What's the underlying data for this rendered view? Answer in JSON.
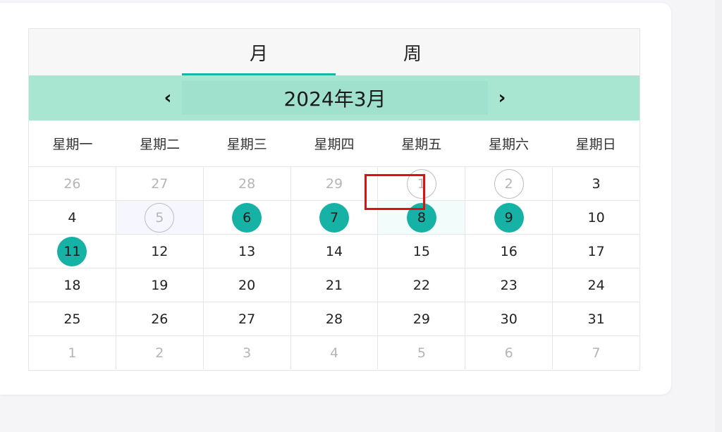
{
  "tabs": [
    {
      "label": "月",
      "active": true
    },
    {
      "label": "周",
      "active": false
    }
  ],
  "header": {
    "month_label": "2024年3月",
    "prev_icon": "‹",
    "next_icon": "›"
  },
  "weekdays": [
    "星期一",
    "星期二",
    "星期三",
    "星期四",
    "星期五",
    "星期六",
    "星期日"
  ],
  "weeks": [
    [
      {
        "day": "26",
        "state": "muted"
      },
      {
        "day": "27",
        "state": "muted"
      },
      {
        "day": "28",
        "state": "muted"
      },
      {
        "day": "29",
        "state": "muted"
      },
      {
        "day": "1",
        "state": "outlined"
      },
      {
        "day": "2",
        "state": "outlined"
      },
      {
        "day": "3",
        "state": "normal"
      }
    ],
    [
      {
        "day": "4",
        "state": "normal"
      },
      {
        "day": "5",
        "state": "outlined"
      },
      {
        "day": "6",
        "state": "filled"
      },
      {
        "day": "7",
        "state": "filled"
      },
      {
        "day": "8",
        "state": "filled"
      },
      {
        "day": "9",
        "state": "filled"
      },
      {
        "day": "10",
        "state": "normal"
      }
    ],
    [
      {
        "day": "11",
        "state": "filled"
      },
      {
        "day": "12",
        "state": "normal"
      },
      {
        "day": "13",
        "state": "normal"
      },
      {
        "day": "14",
        "state": "normal"
      },
      {
        "day": "15",
        "state": "normal"
      },
      {
        "day": "16",
        "state": "normal"
      },
      {
        "day": "17",
        "state": "normal"
      }
    ],
    [
      {
        "day": "18",
        "state": "normal"
      },
      {
        "day": "19",
        "state": "normal"
      },
      {
        "day": "20",
        "state": "normal"
      },
      {
        "day": "21",
        "state": "normal"
      },
      {
        "day": "22",
        "state": "normal"
      },
      {
        "day": "23",
        "state": "normal"
      },
      {
        "day": "24",
        "state": "normal"
      }
    ],
    [
      {
        "day": "25",
        "state": "normal"
      },
      {
        "day": "26",
        "state": "normal"
      },
      {
        "day": "27",
        "state": "normal"
      },
      {
        "day": "28",
        "state": "normal"
      },
      {
        "day": "29",
        "state": "normal"
      },
      {
        "day": "30",
        "state": "normal"
      },
      {
        "day": "31",
        "state": "normal"
      }
    ],
    [
      {
        "day": "1",
        "state": "muted"
      },
      {
        "day": "2",
        "state": "muted"
      },
      {
        "day": "3",
        "state": "muted"
      },
      {
        "day": "4",
        "state": "muted"
      },
      {
        "day": "5",
        "state": "muted"
      },
      {
        "day": "6",
        "state": "muted"
      },
      {
        "day": "7",
        "state": "muted"
      }
    ]
  ],
  "selected_day": "8",
  "colors": {
    "accent": "#17b2a6",
    "month_bar": "#a8e6d2",
    "selection_border": "#e01010"
  }
}
